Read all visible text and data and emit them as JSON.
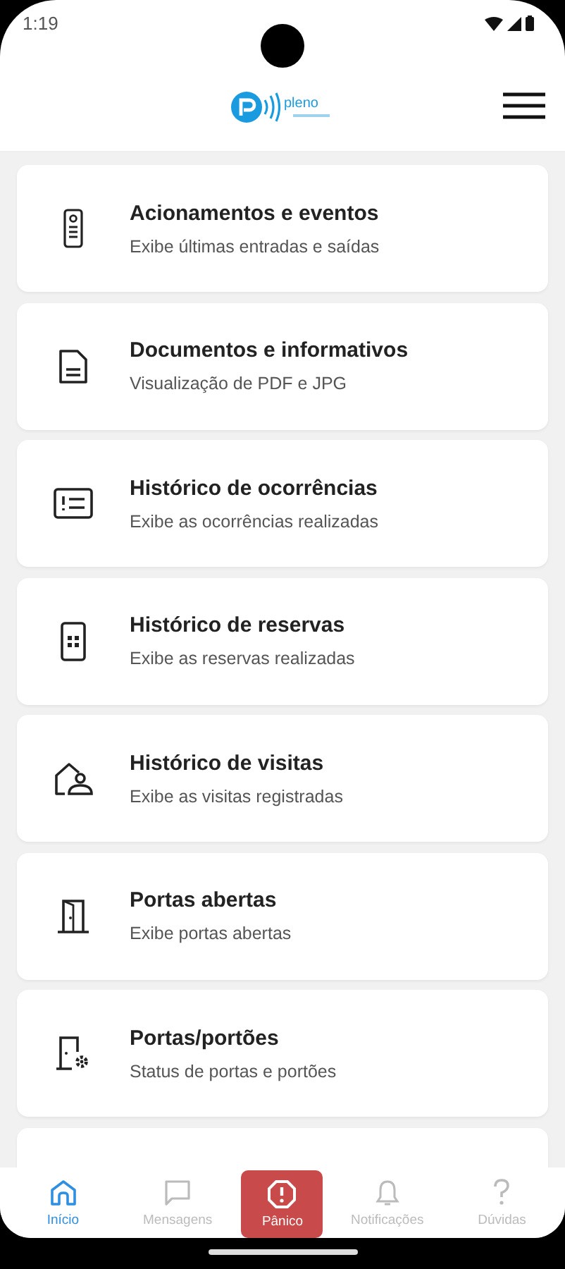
{
  "status_bar": {
    "time": "1:19"
  },
  "header": {
    "logo_text": "pleno"
  },
  "menu_items": [
    {
      "title": "Acionamentos e eventos",
      "subtitle": "Exibe últimas entradas e saídas"
    },
    {
      "title": "Documentos e informativos",
      "subtitle": "Visualização de PDF e JPG"
    },
    {
      "title": "Histórico de ocorrências",
      "subtitle": "Exibe as ocorrências realizadas"
    },
    {
      "title": "Histórico de reservas",
      "subtitle": "Exibe as reservas realizadas"
    },
    {
      "title": "Histórico de visitas",
      "subtitle": "Exibe as visitas registradas"
    },
    {
      "title": "Portas abertas",
      "subtitle": "Exibe portas abertas"
    },
    {
      "title": "Portas/portões",
      "subtitle": "Status de portas e portões"
    }
  ],
  "bottom_nav": [
    {
      "label": "Início",
      "selected": true,
      "kind": "tab"
    },
    {
      "label": "Mensagens",
      "selected": false,
      "kind": "tab"
    },
    {
      "label": "Pânico",
      "selected": false,
      "kind": "panic"
    },
    {
      "label": "Notificações",
      "selected": false,
      "kind": "tab"
    },
    {
      "label": "Dúvidas",
      "selected": false,
      "kind": "tab"
    }
  ]
}
